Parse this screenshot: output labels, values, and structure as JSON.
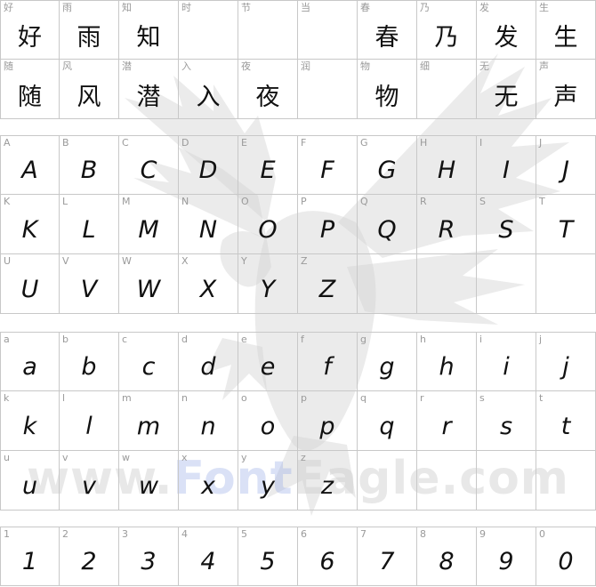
{
  "watermark": {
    "text_a": "www.",
    "text_b": "Font",
    "text_c": "Eagle.com"
  },
  "chinese": [
    {
      "ref": "好",
      "glyph": "好"
    },
    {
      "ref": "雨",
      "glyph": "雨"
    },
    {
      "ref": "知",
      "glyph": "知"
    },
    {
      "ref": "时",
      "glyph": ""
    },
    {
      "ref": "节",
      "glyph": ""
    },
    {
      "ref": "当",
      "glyph": ""
    },
    {
      "ref": "春",
      "glyph": "春"
    },
    {
      "ref": "乃",
      "glyph": "乃"
    },
    {
      "ref": "发",
      "glyph": "发"
    },
    {
      "ref": "生",
      "glyph": "生"
    },
    {
      "ref": "随",
      "glyph": "随"
    },
    {
      "ref": "风",
      "glyph": "风"
    },
    {
      "ref": "潜",
      "glyph": "潜"
    },
    {
      "ref": "入",
      "glyph": "入"
    },
    {
      "ref": "夜",
      "glyph": "夜"
    },
    {
      "ref": "润",
      "glyph": ""
    },
    {
      "ref": "物",
      "glyph": "物"
    },
    {
      "ref": "细",
      "glyph": ""
    },
    {
      "ref": "无",
      "glyph": "无"
    },
    {
      "ref": "声",
      "glyph": "声"
    }
  ],
  "upper": [
    {
      "ref": "A",
      "glyph": "A"
    },
    {
      "ref": "B",
      "glyph": "B"
    },
    {
      "ref": "C",
      "glyph": "C"
    },
    {
      "ref": "D",
      "glyph": "D"
    },
    {
      "ref": "E",
      "glyph": "E"
    },
    {
      "ref": "F",
      "glyph": "F"
    },
    {
      "ref": "G",
      "glyph": "G"
    },
    {
      "ref": "H",
      "glyph": "H"
    },
    {
      "ref": "I",
      "glyph": "I"
    },
    {
      "ref": "J",
      "glyph": "J"
    },
    {
      "ref": "K",
      "glyph": "K"
    },
    {
      "ref": "L",
      "glyph": "L"
    },
    {
      "ref": "M",
      "glyph": "M"
    },
    {
      "ref": "N",
      "glyph": "N"
    },
    {
      "ref": "O",
      "glyph": "O"
    },
    {
      "ref": "P",
      "glyph": "P"
    },
    {
      "ref": "Q",
      "glyph": "Q"
    },
    {
      "ref": "R",
      "glyph": "R"
    },
    {
      "ref": "S",
      "glyph": "S"
    },
    {
      "ref": "T",
      "glyph": "T"
    },
    {
      "ref": "U",
      "glyph": "U"
    },
    {
      "ref": "V",
      "glyph": "V"
    },
    {
      "ref": "W",
      "glyph": "W"
    },
    {
      "ref": "X",
      "glyph": "X"
    },
    {
      "ref": "Y",
      "glyph": "Y"
    },
    {
      "ref": "Z",
      "glyph": "Z"
    },
    {
      "ref": "",
      "glyph": ""
    },
    {
      "ref": "",
      "glyph": ""
    },
    {
      "ref": "",
      "glyph": ""
    },
    {
      "ref": "",
      "glyph": ""
    }
  ],
  "lower": [
    {
      "ref": "a",
      "glyph": "a"
    },
    {
      "ref": "b",
      "glyph": "b"
    },
    {
      "ref": "c",
      "glyph": "c"
    },
    {
      "ref": "d",
      "glyph": "d"
    },
    {
      "ref": "e",
      "glyph": "e"
    },
    {
      "ref": "f",
      "glyph": "f"
    },
    {
      "ref": "g",
      "glyph": "g"
    },
    {
      "ref": "h",
      "glyph": "h"
    },
    {
      "ref": "i",
      "glyph": "i"
    },
    {
      "ref": "j",
      "glyph": "j"
    },
    {
      "ref": "k",
      "glyph": "k"
    },
    {
      "ref": "l",
      "glyph": "l"
    },
    {
      "ref": "m",
      "glyph": "m"
    },
    {
      "ref": "n",
      "glyph": "n"
    },
    {
      "ref": "o",
      "glyph": "o"
    },
    {
      "ref": "p",
      "glyph": "p"
    },
    {
      "ref": "q",
      "glyph": "q"
    },
    {
      "ref": "r",
      "glyph": "r"
    },
    {
      "ref": "s",
      "glyph": "s"
    },
    {
      "ref": "t",
      "glyph": "t"
    },
    {
      "ref": "u",
      "glyph": "u"
    },
    {
      "ref": "v",
      "glyph": "v"
    },
    {
      "ref": "w",
      "glyph": "w"
    },
    {
      "ref": "x",
      "glyph": "x"
    },
    {
      "ref": "y",
      "glyph": "y"
    },
    {
      "ref": "z",
      "glyph": "z"
    },
    {
      "ref": "",
      "glyph": ""
    },
    {
      "ref": "",
      "glyph": ""
    },
    {
      "ref": "",
      "glyph": ""
    },
    {
      "ref": "",
      "glyph": ""
    }
  ],
  "digits": [
    {
      "ref": "1",
      "glyph": "1"
    },
    {
      "ref": "2",
      "glyph": "2"
    },
    {
      "ref": "3",
      "glyph": "3"
    },
    {
      "ref": "4",
      "glyph": "4"
    },
    {
      "ref": "5",
      "glyph": "5"
    },
    {
      "ref": "6",
      "glyph": "6"
    },
    {
      "ref": "7",
      "glyph": "7"
    },
    {
      "ref": "8",
      "glyph": "8"
    },
    {
      "ref": "9",
      "glyph": "9"
    },
    {
      "ref": "0",
      "glyph": "0"
    }
  ]
}
